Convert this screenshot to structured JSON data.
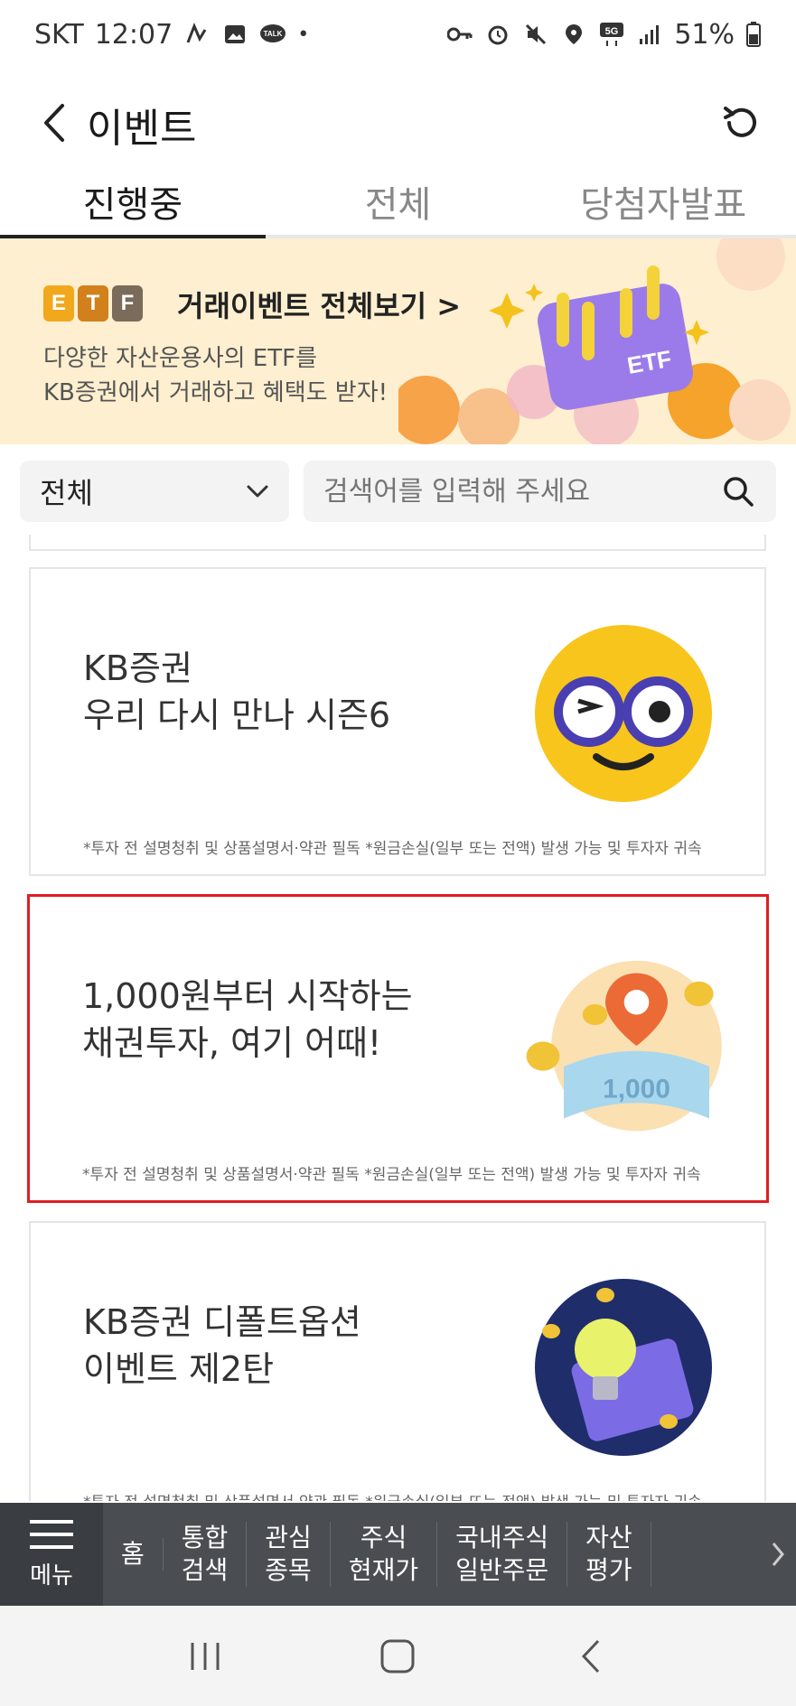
{
  "status_bar": {
    "carrier": "SKT",
    "time": "12:07",
    "battery": "51%",
    "network": "5G",
    "icons": [
      "alarm-icon",
      "gallery-icon",
      "talk-icon",
      "key-icon",
      "mute-icon",
      "location-icon",
      "signal-icon",
      "battery-icon"
    ]
  },
  "header": {
    "title": "이벤트"
  },
  "tabs": [
    {
      "label": "진행중",
      "active": true
    },
    {
      "label": "전체",
      "active": false
    },
    {
      "label": "당첨자발표",
      "active": false
    }
  ],
  "banner": {
    "badge": [
      "E",
      "T",
      "F"
    ],
    "title": "거래이벤트 전체보기 >",
    "line1": "다양한 자산운용사의 ETF를",
    "line2": "KB증권에서 거래하고 혜택도 받자!",
    "art_label": "ETF"
  },
  "filter": {
    "select_value": "전체",
    "search_placeholder": "검색어를 입력해 주세요"
  },
  "events": [
    {
      "title": "KB증권\n우리 다시 만나 시즌6",
      "disclaimer": "*투자 전 설명청취 및 상품설명서·약관 필독   *원금손실(일부 또는 전액) 발생 가능 및 투자자 귀속"
    },
    {
      "title": "1,000원부터 시작하는\n채권투자, 여기 어때!",
      "disclaimer": "*투자 전 설명청취 및 상품설명서·약관 필독   *원금손실(일부 또는 전액) 발생 가능 및 투자자 귀속",
      "art_label": "1,000"
    },
    {
      "title": "KB증권 디폴트옵션\n이벤트 제2탄",
      "disclaimer": "*투자 전 설명청취 및 상품설명서·약관 필독   *원금손실(일부 또는 전액) 발생 가능 및 투자자 귀속"
    }
  ],
  "bottom_nav": {
    "menu_label": "메뉴",
    "items": [
      "홈",
      "통합\n검색",
      "관심\n종목",
      "주식\n현재가",
      "국내주식\n일반주문",
      "자산\n평가"
    ]
  },
  "colors": {
    "banner_bg": "#fdefcf",
    "selected_border": "#e01e24",
    "bottom_bar": "#4a4d52"
  }
}
